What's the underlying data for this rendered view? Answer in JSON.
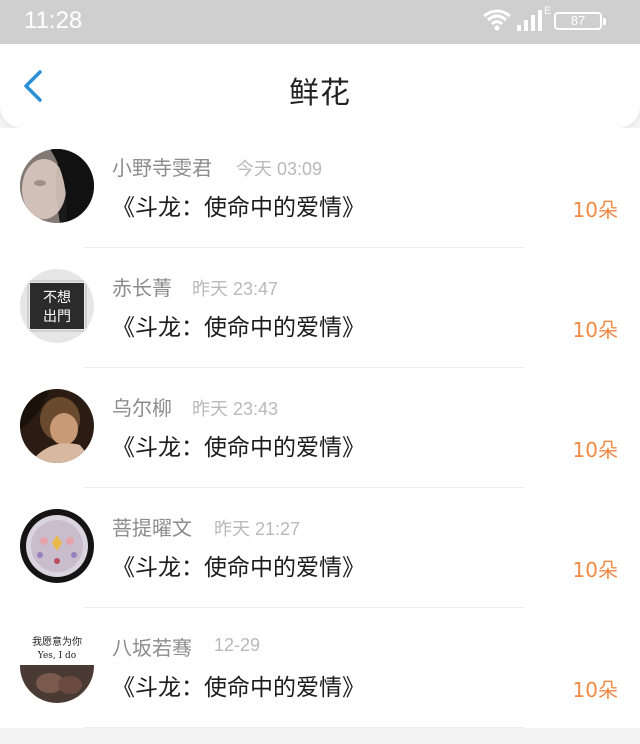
{
  "status_bar": {
    "time": "11:28",
    "network_label": "E",
    "battery": "87"
  },
  "header": {
    "title": "鲜花"
  },
  "items": [
    {
      "user": "小野寺雯君",
      "time": "今天 03:09",
      "book": "《斗龙：使命中的爱情》",
      "count": "10朵"
    },
    {
      "user": "赤长菁",
      "time": "昨天 23:47",
      "book": "《斗龙：使命中的爱情》",
      "count": "10朵",
      "avatar_text": [
        "不想",
        "出門"
      ]
    },
    {
      "user": "乌尔柳",
      "time": "昨天 23:43",
      "book": "《斗龙：使命中的爱情》",
      "count": "10朵"
    },
    {
      "user": "菩提曜文",
      "time": "昨天 21:27",
      "book": "《斗龙：使命中的爱情》",
      "count": "10朵"
    },
    {
      "user": "八坂若骞",
      "time": "12-29",
      "book": "《斗龙：使命中的爱情》",
      "count": "10朵",
      "avatar_text": [
        "我愿意为你",
        "Yes, I do"
      ]
    }
  ],
  "colors": {
    "accent": "#f18a44",
    "back_arrow": "#2b8fd6",
    "status_bar": "#cfcfcf"
  }
}
